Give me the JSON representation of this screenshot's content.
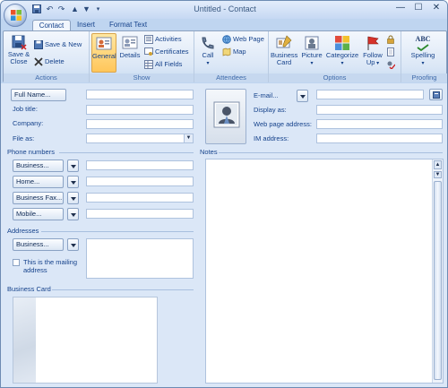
{
  "window": {
    "title": "Untitled - Contact",
    "minimize": "—",
    "maximize": "☐",
    "close": "✕"
  },
  "qat": [
    "save-icon",
    "undo-icon",
    "redo-icon",
    "up-icon",
    "down-icon",
    "customize-icon"
  ],
  "tabs": [
    "Contact",
    "Insert",
    "Format Text"
  ],
  "ribbon": {
    "actions": {
      "label": "Actions",
      "save_close": "Save &",
      "save_close2": "Close",
      "save_new": "Save & New",
      "delete": "Delete"
    },
    "show": {
      "label": "Show",
      "general": "General",
      "details": "Details",
      "activities": "Activities",
      "certificates": "Certificates",
      "all_fields": "All Fields"
    },
    "attendees": {
      "label": "Attendees",
      "call": "Call",
      "web_page": "Web Page",
      "map": "Map"
    },
    "options": {
      "label": "Options",
      "business_card": "Business",
      "business_card2": "Card",
      "picture": "Picture",
      "categorize": "Categorize",
      "follow_up": "Follow",
      "follow_up2": "Up"
    },
    "proofing": {
      "label": "Proofing",
      "spelling": "Spelling",
      "abc": "ABC"
    }
  },
  "form": {
    "full_name": "Full Name...",
    "job_title": "Job title:",
    "company": "Company:",
    "file_as": "File as:",
    "phone_section": "Phone numbers",
    "phones": [
      "Business...",
      "Home...",
      "Business Fax...",
      "Mobile..."
    ],
    "address_section": "Addresses",
    "address_type": "Business...",
    "mailing": "This is the mailing",
    "mailing2": "address",
    "card_section": "Business Card",
    "email": "E-mail...",
    "display_as": "Display as:",
    "web_page": "Web page address:",
    "im_address": "IM address:",
    "notes": "Notes"
  },
  "colors": {
    "accent": "#15428b",
    "ribbon_bg": "#dbe7f6",
    "window_bg": "#dbe7f7"
  }
}
